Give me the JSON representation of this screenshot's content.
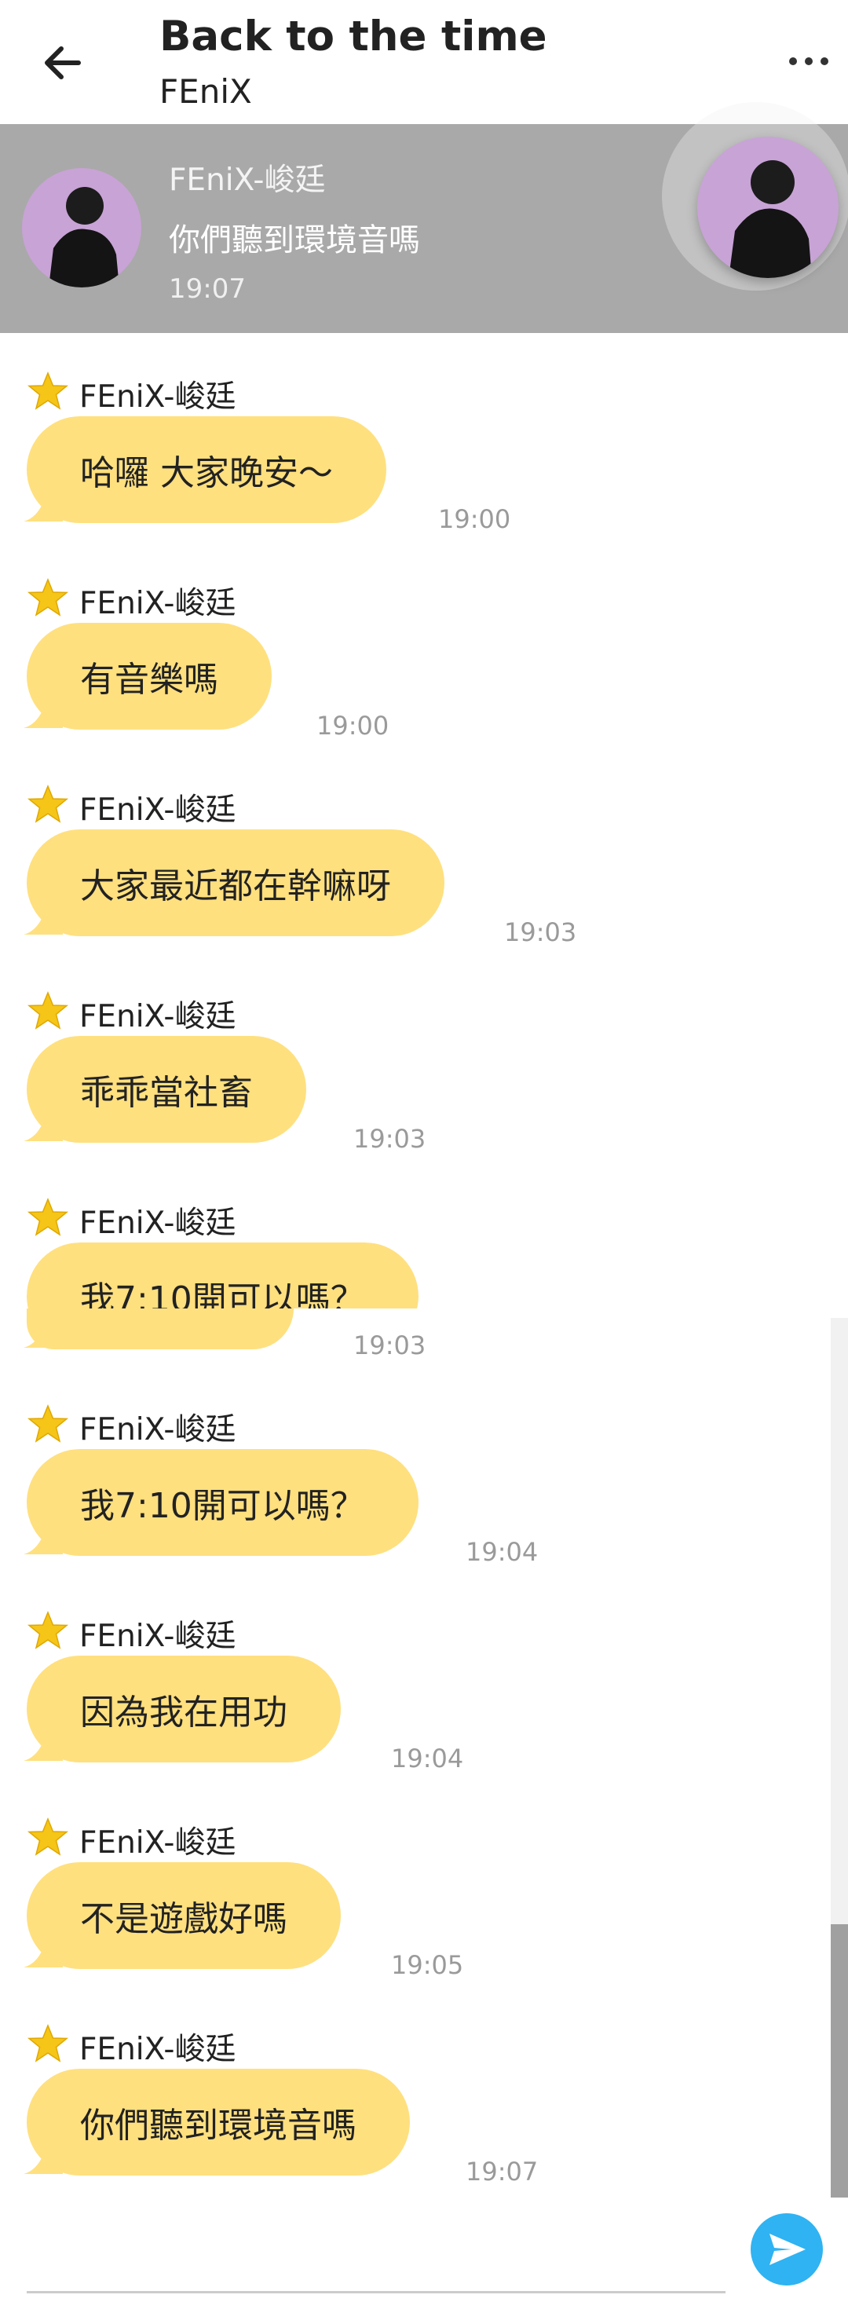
{
  "header": {
    "title": "Back to the time",
    "subtitle": "FEniX"
  },
  "banner": {
    "name": "FEniX-峻廷",
    "message": "你們聽到環境音嗎",
    "time": "19:07"
  },
  "messages": [
    {
      "sender": "FEniX-峻廷",
      "text": "哈囉 大家晚安～",
      "time": "19:00"
    },
    {
      "sender": "FEniX-峻廷",
      "text": "有音樂嗎",
      "time": "19:00"
    },
    {
      "sender": "FEniX-峻廷",
      "text": "大家最近都在幹嘛呀",
      "time": "19:03"
    },
    {
      "sender": "FEniX-峻廷",
      "text": "乖乖當社畜",
      "time": "19:03"
    },
    {
      "sender": "FEniX-峻廷",
      "text": "我7:10開可以嗎？",
      "time": "19:03"
    },
    {
      "sender": "FEniX-峻廷",
      "text": "我7:10開可以嗎？",
      "time": "19:04"
    },
    {
      "sender": "FEniX-峻廷",
      "text": "因為我在用功",
      "time": "19:04"
    },
    {
      "sender": "FEniX-峻廷",
      "text": "不是遊戲好嗎",
      "time": "19:05"
    },
    {
      "sender": "FEniX-峻廷",
      "text": "你們聽到環境音嗎",
      "time": "19:07"
    }
  ],
  "colors": {
    "bubble": "#ffe07f",
    "send_button": "#2fb3f2",
    "banner_bg": "#a9a9a9",
    "star": "#f5c518",
    "avatar_bg": "#c8a3d6"
  },
  "icons": {
    "back": "arrow-left-icon",
    "more": "more-vertical-dots-icon",
    "star": "verified-star-icon",
    "send": "paper-plane-send-icon"
  }
}
